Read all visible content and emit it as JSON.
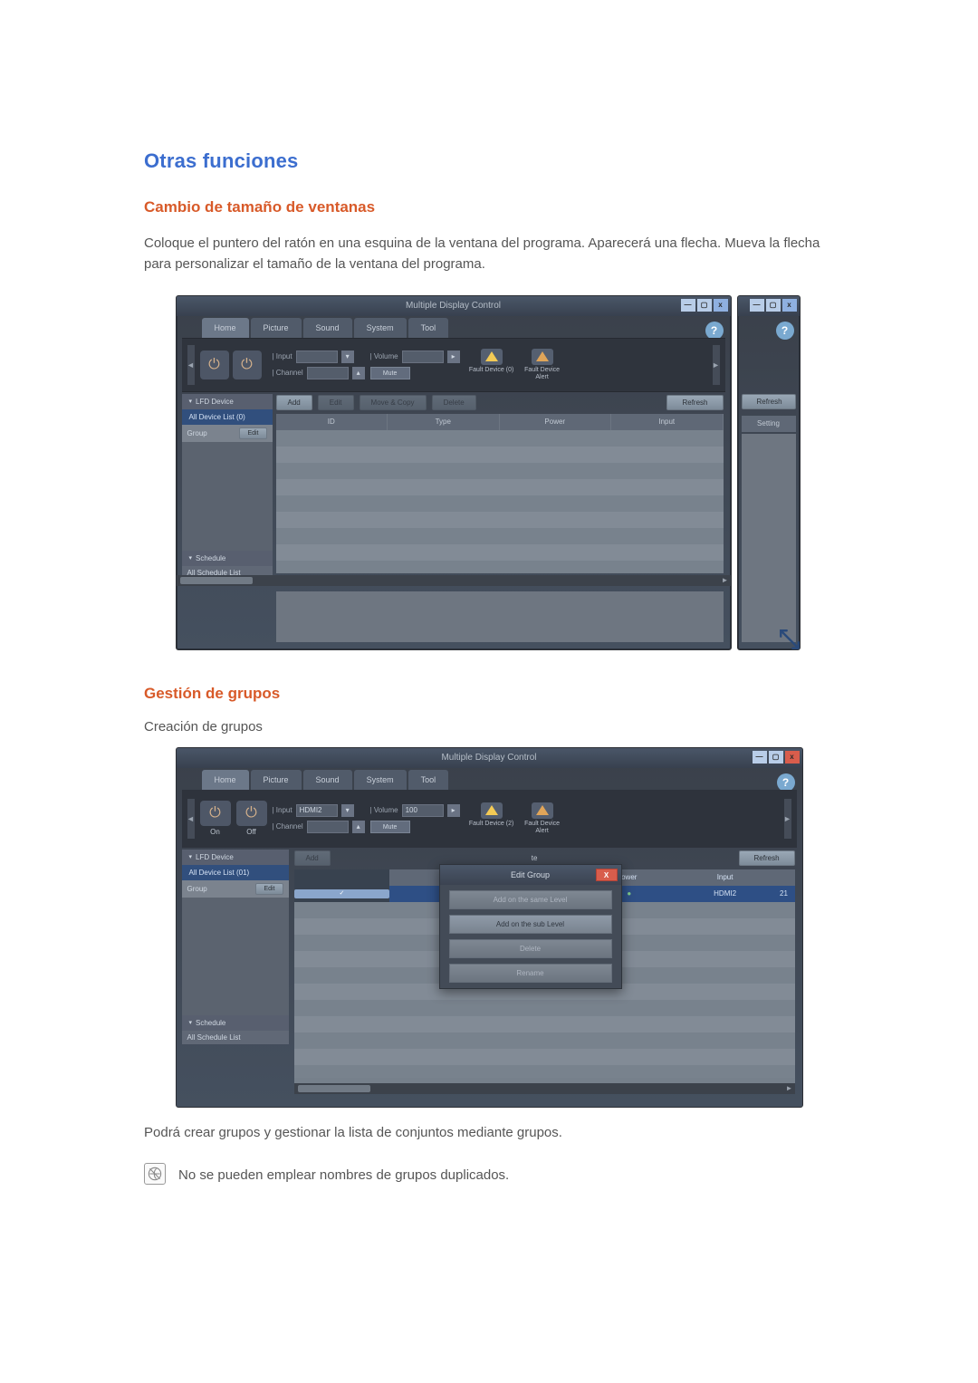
{
  "headings": {
    "h1": "Otras funciones",
    "h2a": "Cambio de tamaño de ventanas",
    "h2b": "Gestión de grupos",
    "h3": "Creación de grupos"
  },
  "para1": "Coloque el puntero del ratón en una esquina de la ventana del programa. Aparecerá una flecha. Mueva la flecha para personalizar el tamaño de la ventana del programa.",
  "para2": "Podrá crear grupos y gestionar la lista de conjuntos mediante grupos.",
  "note": "No se pueden emplear nombres de grupos duplicados.",
  "app": {
    "title": "Multiple Display Control",
    "tabs": {
      "home": "Home",
      "picture": "Picture",
      "sound": "Sound",
      "system": "System",
      "tool": "Tool"
    },
    "ribbon": {
      "onLabel": "On",
      "offLabel": "Off",
      "input": "| Input",
      "channel": "| Channel",
      "hdmi2": "HDMI2",
      "volume": "| Volume",
      "volval": "100",
      "mute": "Mute",
      "fault0": "Fault Device (0)",
      "fault2": "Fault Device (2)",
      "alert": "Fault Device Alert"
    },
    "toolbar": {
      "add": "Add",
      "edit": "Edit",
      "move": "Move & Copy",
      "delete": "Delete",
      "refresh": "Refresh"
    },
    "left": {
      "lfd": "LFD Device",
      "all0": "All Device List (0)",
      "all01": "All Device List (01)",
      "group": "Group",
      "editBtn": "Edit",
      "schedule": "Schedule",
      "allSched": "All Schedule List"
    },
    "gridcols": {
      "id": "ID",
      "type": "Type",
      "power": "Power",
      "input": "Input"
    },
    "gridcols2": {
      "wer": "ower",
      "input": "Input",
      "te": "te"
    },
    "row1": {
      "input": "HDMI2",
      "num": "21"
    },
    "side": {
      "setting": "Setting"
    },
    "popup": {
      "title": "Edit Group",
      "addSame": "Add on the same Level",
      "addSub": "Add on the sub Level",
      "delete": "Delete",
      "rename": "Rename"
    }
  }
}
